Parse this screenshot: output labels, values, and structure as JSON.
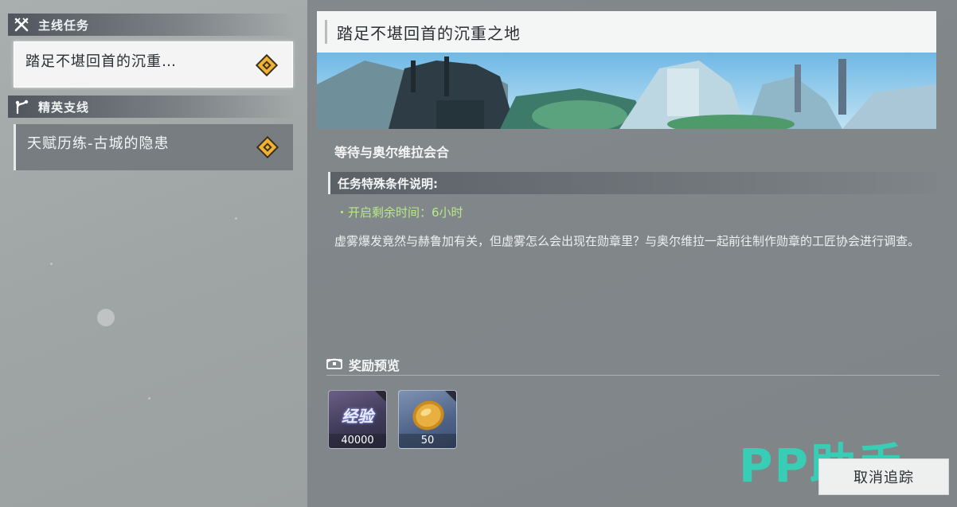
{
  "sidebar": {
    "categories": [
      {
        "label": "主线任务",
        "icon": "crossed-swords-icon"
      },
      {
        "label": "精英支线",
        "icon": "branch-icon"
      }
    ],
    "quests": [
      {
        "title": "踏足不堪回首的沉重…",
        "state": "active",
        "icon": "quest-diamond-icon"
      },
      {
        "title": "天赋历练-古城的隐患",
        "state": "inactive",
        "icon": "quest-diamond-icon"
      }
    ]
  },
  "detail": {
    "title": "踏足不堪回首的沉重之地",
    "objective": "等待与奥尔维拉会合",
    "conditions_header": "任务特殊条件说明:",
    "condition": "・开启剩余时间：6小时",
    "description": "虚雾爆发竟然与赫鲁加有关，但虚雾怎么会出现在勋章里？与奥尔维拉一起前往制作勋章的工匠协会进行调查。",
    "rewards_header": "奖励预览",
    "rewards": [
      {
        "label": "经验",
        "count": "40000",
        "icon": "exp-icon"
      },
      {
        "label": "",
        "count": "50",
        "icon": "gold-coin-icon"
      }
    ]
  },
  "actions": {
    "cancel_tracking": "取消追踪"
  },
  "watermark": "PP助手",
  "colors": {
    "condition_green": "#b8e986",
    "quest_marker": "#f2b233",
    "watermark_teal": "#30d6ba"
  }
}
